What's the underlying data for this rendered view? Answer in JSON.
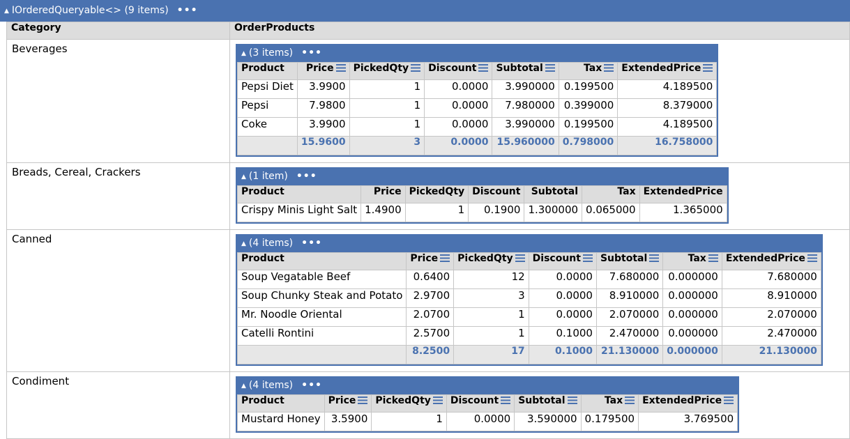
{
  "header": {
    "title": "IOrderedQueryable<> (9 items)",
    "dots": "•••"
  },
  "columns": {
    "category": "Category",
    "order_products": "OrderProducts"
  },
  "groups": [
    {
      "category": "Beverages",
      "items_label": "(3 items)",
      "sortable": true,
      "col_headers": [
        "Product",
        "Price",
        "PickedQty",
        "Discount",
        "Subtotal",
        "Tax",
        "ExtendedPrice"
      ],
      "rows": [
        [
          "Pepsi Diet",
          "3.9900",
          "1",
          "0.0000",
          "3.990000",
          "0.199500",
          "4.189500"
        ],
        [
          "Pepsi",
          "7.9800",
          "1",
          "0.0000",
          "7.980000",
          "0.399000",
          "8.379000"
        ],
        [
          "Coke",
          "3.9900",
          "1",
          "0.0000",
          "3.990000",
          "0.199500",
          "4.189500"
        ]
      ],
      "totals": [
        "",
        "15.9600",
        "3",
        "0.0000",
        "15.960000",
        "0.798000",
        "16.758000"
      ]
    },
    {
      "category": "Breads, Cereal, Crackers",
      "items_label": "(1 item)",
      "sortable": false,
      "col_headers": [
        "Product",
        "Price",
        "PickedQty",
        "Discount",
        "Subtotal",
        "Tax",
        "ExtendedPrice"
      ],
      "rows": [
        [
          "Crispy Minis Light Salt",
          "1.4900",
          "1",
          "0.1900",
          "1.300000",
          "0.065000",
          "1.365000"
        ]
      ],
      "totals": null
    },
    {
      "category": "Canned",
      "items_label": "(4 items)",
      "sortable": true,
      "col_headers": [
        "Product",
        "Price",
        "PickedQty",
        "Discount",
        "Subtotal",
        "Tax",
        "ExtendedPrice"
      ],
      "rows": [
        [
          "Soup Vegatable Beef",
          "0.6400",
          "12",
          "0.0000",
          "7.680000",
          "0.000000",
          "7.680000"
        ],
        [
          "Soup Chunky Steak and Potato",
          "2.9700",
          "3",
          "0.0000",
          "8.910000",
          "0.000000",
          "8.910000"
        ],
        [
          "Mr. Noodle Oriental",
          "2.0700",
          "1",
          "0.0000",
          "2.070000",
          "0.000000",
          "2.070000"
        ],
        [
          "Catelli Rontini",
          "2.5700",
          "1",
          "0.1000",
          "2.470000",
          "0.000000",
          "2.470000"
        ]
      ],
      "totals": [
        "",
        "8.2500",
        "17",
        "0.1000",
        "21.130000",
        "0.000000",
        "21.130000"
      ]
    },
    {
      "category": "Condiment",
      "items_label": "(4 items)",
      "sortable": true,
      "col_headers": [
        "Product",
        "Price",
        "PickedQty",
        "Discount",
        "Subtotal",
        "Tax",
        "ExtendedPrice"
      ],
      "rows": [
        [
          "Mustard Honey",
          "3.5900",
          "1",
          "0.0000",
          "3.590000",
          "0.179500",
          "3.769500"
        ]
      ],
      "totals": null
    }
  ]
}
